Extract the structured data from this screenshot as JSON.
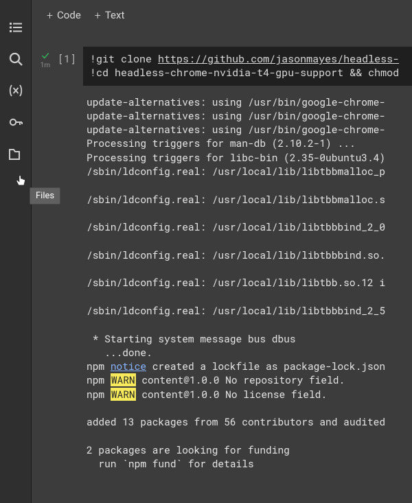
{
  "toolbar": {
    "code_label": "Code",
    "text_label": "Text"
  },
  "sidebar": {
    "tooltip": "Files"
  },
  "cell": {
    "exec_time": "1m",
    "index": "[1]",
    "code": {
      "line1_url": "https://github.com/jasonmayes/headless-",
      "line2_rest": "cd headless-chrome-nvidia-t4-gpu-support && chmod"
    }
  },
  "output": {
    "lines": [
      {
        "t": "update-alternatives: using /usr/bin/google-chrome-"
      },
      {
        "t": "update-alternatives: using /usr/bin/google-chrome-"
      },
      {
        "t": "update-alternatives: using /usr/bin/google-chrome-"
      },
      {
        "t": "Processing triggers for man-db (2.10.2-1) ..."
      },
      {
        "t": "Processing triggers for libc-bin (2.35-0ubuntu3.4)"
      },
      {
        "t": "/sbin/ldconfig.real: /usr/local/lib/libtbbmalloc_p"
      },
      {
        "t": ""
      },
      {
        "t": "/sbin/ldconfig.real: /usr/local/lib/libtbbmalloc.s"
      },
      {
        "t": ""
      },
      {
        "t": "/sbin/ldconfig.real: /usr/local/lib/libtbbbind_2_0"
      },
      {
        "t": ""
      },
      {
        "t": "/sbin/ldconfig.real: /usr/local/lib/libtbbbind.so."
      },
      {
        "t": ""
      },
      {
        "t": "/sbin/ldconfig.real: /usr/local/lib/libtbb.so.12 i"
      },
      {
        "t": ""
      },
      {
        "t": "/sbin/ldconfig.real: /usr/local/lib/libtbbbind_2_5"
      },
      {
        "t": ""
      },
      {
        "t": " * Starting system message bus dbus"
      },
      {
        "t": "   ...done."
      },
      {
        "kind": "notice",
        "pre": "npm ",
        "link": "notice",
        "post": " created a lockfile as package-lock.json"
      },
      {
        "kind": "warn",
        "pre": "npm ",
        "warn": "WARN",
        "post": " content@1.0.0 No repository field."
      },
      {
        "kind": "warn",
        "pre": "npm ",
        "warn": "WARN",
        "post": " content@1.0.0 No license field."
      },
      {
        "t": ""
      },
      {
        "t": "added 13 packages from 56 contributors and audited"
      },
      {
        "t": ""
      },
      {
        "t": "2 packages are looking for funding"
      },
      {
        "t": "  run `npm fund` for details"
      }
    ]
  },
  "git_clone_label": "git clone "
}
